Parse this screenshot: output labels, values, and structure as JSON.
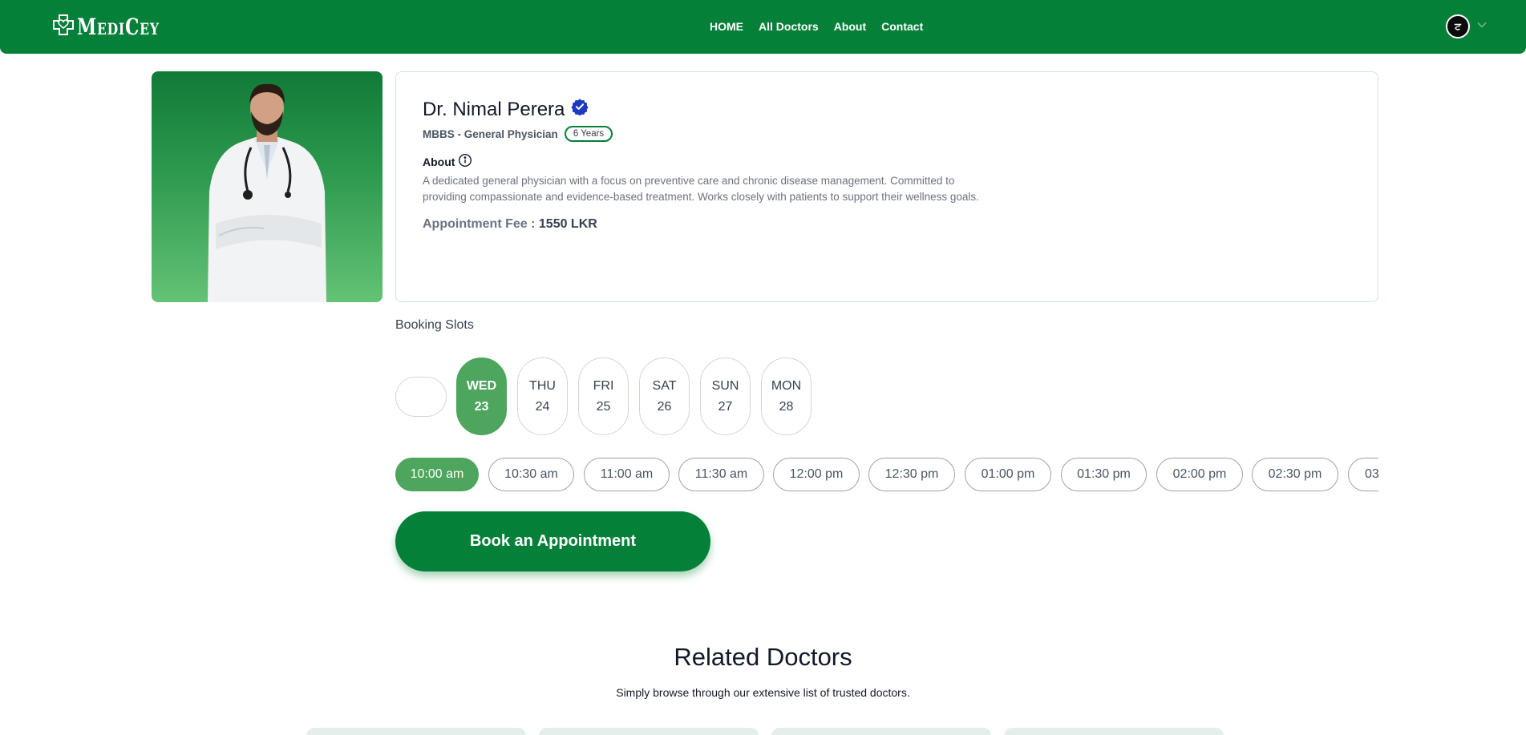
{
  "header": {
    "logo_text": "MediCey",
    "nav": [
      "HOME",
      "All Doctors",
      "About",
      "Contact"
    ],
    "avatar_initial": "ਟ"
  },
  "doctor": {
    "name": "Dr. Nimal Perera",
    "speciality": "MBBS - General Physician",
    "experience": "6 Years",
    "about_label": "About",
    "about_text": "A dedicated general physician with a focus on preventive care and chronic disease management. Committed to providing compassionate and evidence-based treatment. Works closely with patients to support their wellness goals.",
    "fee_label": "Appointment Fee :",
    "fee_value": "1550 LKR"
  },
  "booking": {
    "title": "Booking Slots",
    "days": [
      {
        "day": "WED",
        "date": "23"
      },
      {
        "day": "THU",
        "date": "24"
      },
      {
        "day": "FRI",
        "date": "25"
      },
      {
        "day": "SAT",
        "date": "26"
      },
      {
        "day": "SUN",
        "date": "27"
      },
      {
        "day": "MON",
        "date": "28"
      }
    ],
    "times": [
      "10:00 am",
      "10:30 am",
      "11:00 am",
      "11:30 am",
      "12:00 pm",
      "12:30 pm",
      "01:00 pm",
      "01:30 pm",
      "02:00 pm",
      "02:30 pm",
      "03"
    ],
    "selected_day": 0,
    "selected_time": 0,
    "book_label": "Book an Appointment"
  },
  "related": {
    "title": "Related Doctors",
    "subtitle": "Simply browse through our extensive list of trusted doctors."
  },
  "colors": {
    "brand": "#058039",
    "selected": "#4ea55d",
    "verified": "#1d39c4"
  }
}
